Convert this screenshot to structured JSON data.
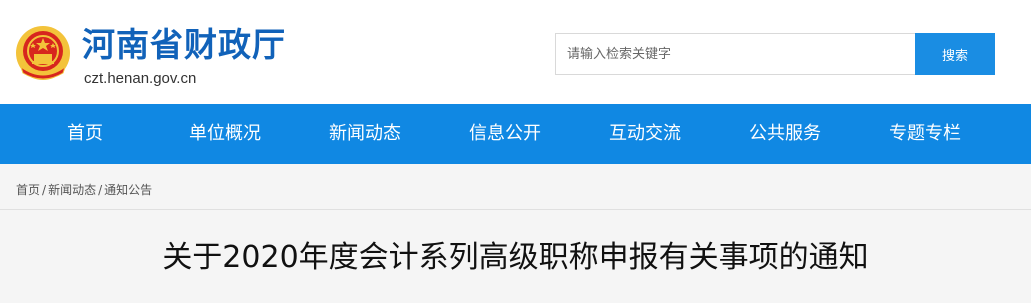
{
  "header": {
    "site_title": "河南省财政厅",
    "site_domain": "czt.henan.gov.cn",
    "emblem_icon": "national-emblem-icon"
  },
  "search": {
    "placeholder": "请输入检索关键字",
    "value": "",
    "button_label": "搜索"
  },
  "nav": {
    "items": [
      {
        "label": "首页"
      },
      {
        "label": "单位概况"
      },
      {
        "label": "新闻动态"
      },
      {
        "label": "信息公开"
      },
      {
        "label": "互动交流"
      },
      {
        "label": "公共服务"
      },
      {
        "label": "专题专栏"
      }
    ]
  },
  "breadcrumb": {
    "items": [
      {
        "label": "首页"
      },
      {
        "label": "新闻动态"
      },
      {
        "label": "通知公告"
      }
    ],
    "separator": "/"
  },
  "article": {
    "title": "关于2020年度会计系列高级职称申报有关事项的通知"
  },
  "colors": {
    "brand_blue": "#1162b9",
    "nav_blue": "#1088e3",
    "search_button": "#1a8de3",
    "emblem_red": "#d7261e",
    "emblem_gold": "#f3c33a"
  }
}
